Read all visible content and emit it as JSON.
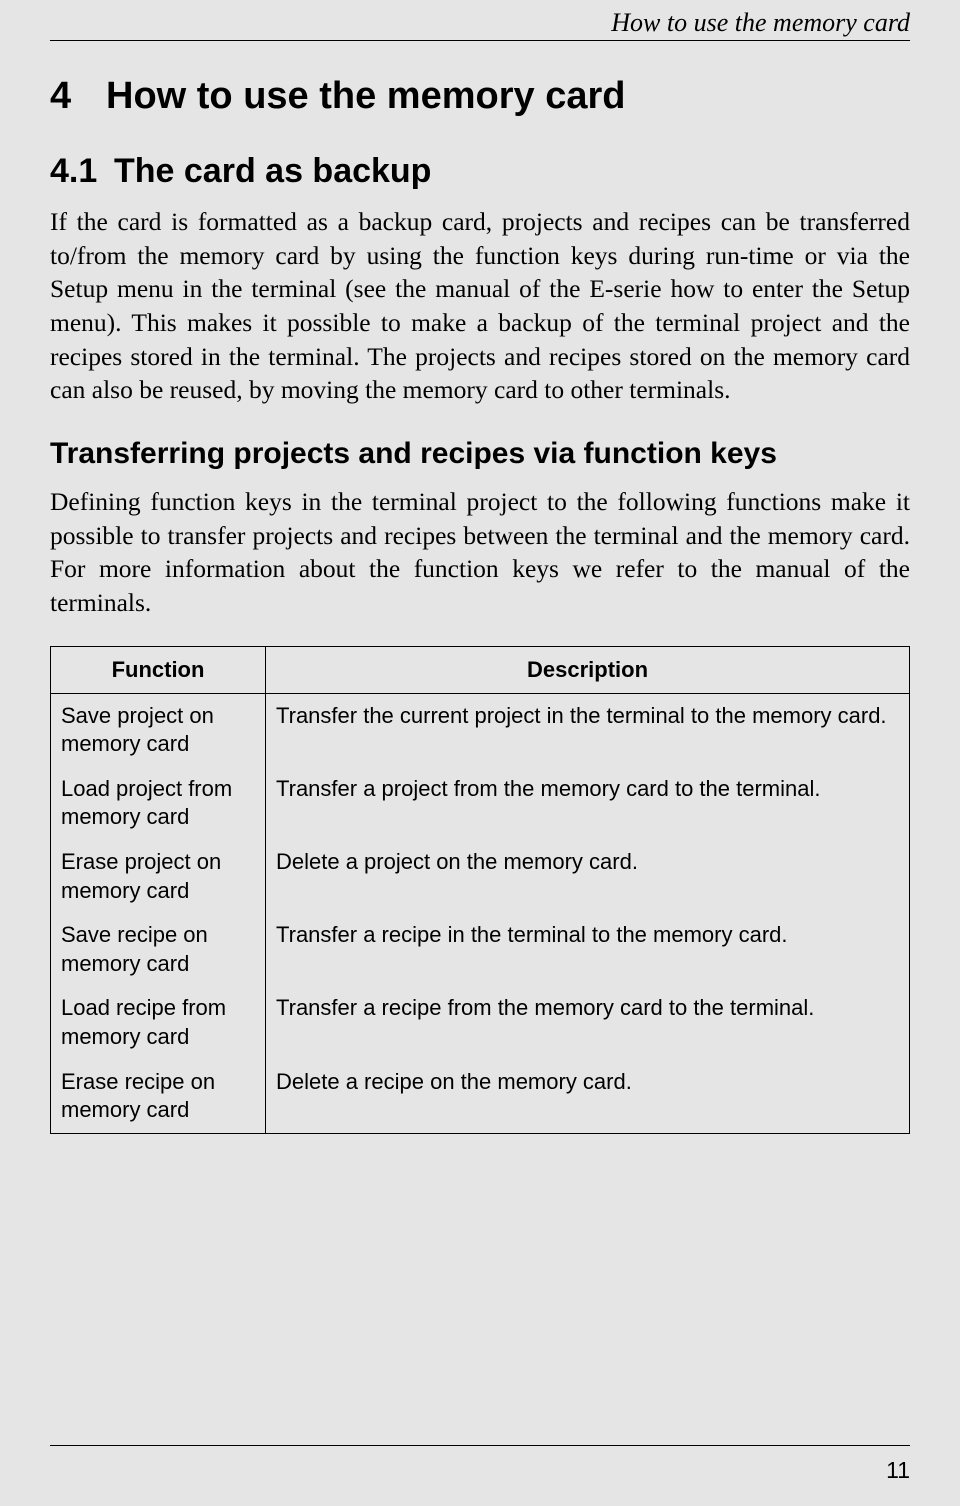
{
  "header": {
    "running_title": "How to use the memory card"
  },
  "sections": {
    "h1_num": "4",
    "h1_title": "How to use the memory card",
    "h2_num": "4.1",
    "h2_title": "The card as backup",
    "para1": "If the card is formatted as a backup card, projects and recipes can be transferred to/from the memory card by using the function keys during run-time or via the Setup menu in the terminal (see the manual of the E-serie how to enter the Setup menu). This makes it possible to make a backup of the terminal project and the recipes stored in the terminal. The projects and recipes stored on the memory card can also be reused, by moving the memory card to other terminals.",
    "h3_title": "Transferring projects and recipes via function keys",
    "para2": "Defining function keys in the terminal project to the following functions make it possible to transfer projects and recipes between the terminal and the memory card. For more information about the function keys we refer to the manual of the terminals."
  },
  "table": {
    "head_function": "Function",
    "head_description": "Description",
    "rows": [
      {
        "func": "Save project on memory card",
        "desc": "Transfer the current project in the terminal to the memory card."
      },
      {
        "func": "Load project from memory card",
        "desc": "Transfer a project from the memory card to the terminal."
      },
      {
        "func": "Erase project on memory card",
        "desc": "Delete a project on the memory card."
      },
      {
        "func": "Save recipe on memory card",
        "desc": "Transfer a recipe in the terminal to the memory card."
      },
      {
        "func": "Load recipe from memory card",
        "desc": "Transfer a recipe from the memory card to the terminal."
      },
      {
        "func": "Erase recipe on memory card",
        "desc": "Delete a recipe on the memory card."
      }
    ]
  },
  "footer": {
    "page_number": "11"
  }
}
